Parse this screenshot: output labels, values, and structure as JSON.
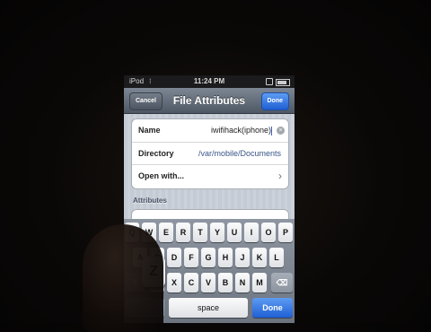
{
  "status": {
    "carrier": "iPod",
    "time": "11:24 PM"
  },
  "navbar": {
    "cancel": "Cancel",
    "title": "File Attributes",
    "done": "Done"
  },
  "fields": {
    "name_label": "Name",
    "name_value": "iwifihack(iphone)",
    "directory_label": "Directory",
    "directory_value": "/var/mobile/Documents",
    "open_with_label": "Open with..."
  },
  "attributes_header": "Attributes",
  "keyboard": {
    "row1": [
      "Q",
      "W",
      "E",
      "R",
      "T",
      "Y",
      "U",
      "I",
      "O",
      "P"
    ],
    "row2": [
      "A",
      "S",
      "D",
      "F",
      "G",
      "H",
      "J",
      "K",
      "L"
    ],
    "row3": [
      "Z",
      "X",
      "C",
      "V",
      "B",
      "N",
      "M"
    ],
    "popup_key": "Z",
    "space": "space",
    "go": "Done"
  },
  "colors": {
    "accent": "#1f5fd4",
    "navbar": "#5a6470"
  },
  "icons": [
    "wifi-icon",
    "lock-icon",
    "battery-icon",
    "clear-text-icon",
    "chevron-right-icon",
    "backspace-icon"
  ]
}
